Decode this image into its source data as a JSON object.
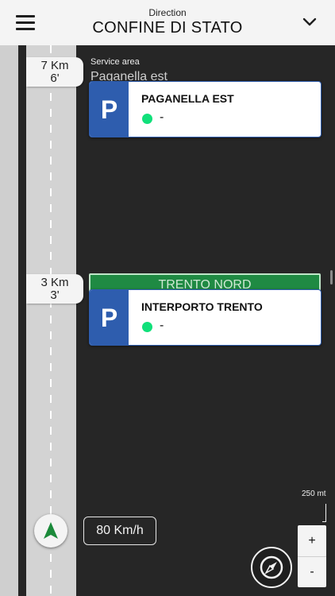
{
  "header": {
    "subtitle": "Direction",
    "title": "CONFINE DI STATO",
    "menu_icon": "hamburger-menu-icon",
    "chevron_icon": "chevron-down-icon"
  },
  "flags": [
    {
      "distance": "7 Km",
      "time": "6'"
    },
    {
      "distance": "3 Km",
      "time": "3'"
    }
  ],
  "service_area": {
    "label": "Service area",
    "name": "Paganella est"
  },
  "exit_sign": {
    "label": "TRENTO NORD",
    "color": "#1f8a43"
  },
  "parkings": [
    {
      "letter": "P",
      "name": "PAGANELLA EST",
      "status": "-",
      "status_color": "#10e07a"
    },
    {
      "letter": "P",
      "name": "INTERPORTO TRENTO",
      "status": "-",
      "status_color": "#10e07a"
    }
  ],
  "controls": {
    "speed": "80 Km/h",
    "scale": "250 mt",
    "zoom_in": "+",
    "zoom_out": "-",
    "nav_icon": "navigation-arrow-icon",
    "compass_icon": "compass-icon"
  },
  "colors": {
    "header_bg": "#f4f4f4",
    "map_bg": "#262626",
    "parking_blue": "#2e5dae",
    "nav_green": "#1b8a3a"
  }
}
